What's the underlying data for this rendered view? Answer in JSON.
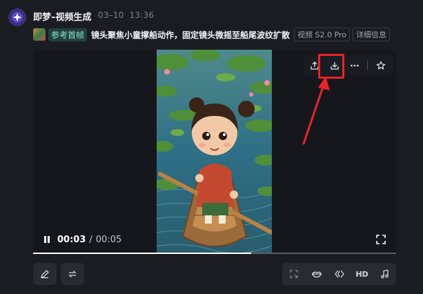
{
  "header": {
    "app_name": "即梦–视频生成",
    "date": "03–10",
    "time": "13:36"
  },
  "prompt": {
    "reference_label": "参考首帧",
    "text": "镜头聚焦小童撑船动作，固定镜头微摇至船尾波纹扩散",
    "model_tag": "视频 S2.0 Pro",
    "details_tag": "详细信息"
  },
  "video_toolbar": {
    "icons": [
      "share-icon",
      "download-icon",
      "more-icon",
      "star-icon"
    ]
  },
  "annotation": {
    "highlight_color": "#e8242a"
  },
  "player": {
    "current_time": "00:03",
    "separator": "/",
    "total_time": "00:05",
    "progress": 0.6
  },
  "bottom_left_icons": [
    "edit-icon",
    "regenerate-icon"
  ],
  "bottom_right_tools": {
    "icons": [
      "frame-select-icon",
      "lip-sync-icon",
      "interpolate-icon",
      "hd-icon",
      "music-icon"
    ],
    "hd_label": "HD"
  },
  "colors": {
    "background": "#1b1c22",
    "reference_tag": "#8fe0cf",
    "accent_avatar": "#3a2f78"
  }
}
